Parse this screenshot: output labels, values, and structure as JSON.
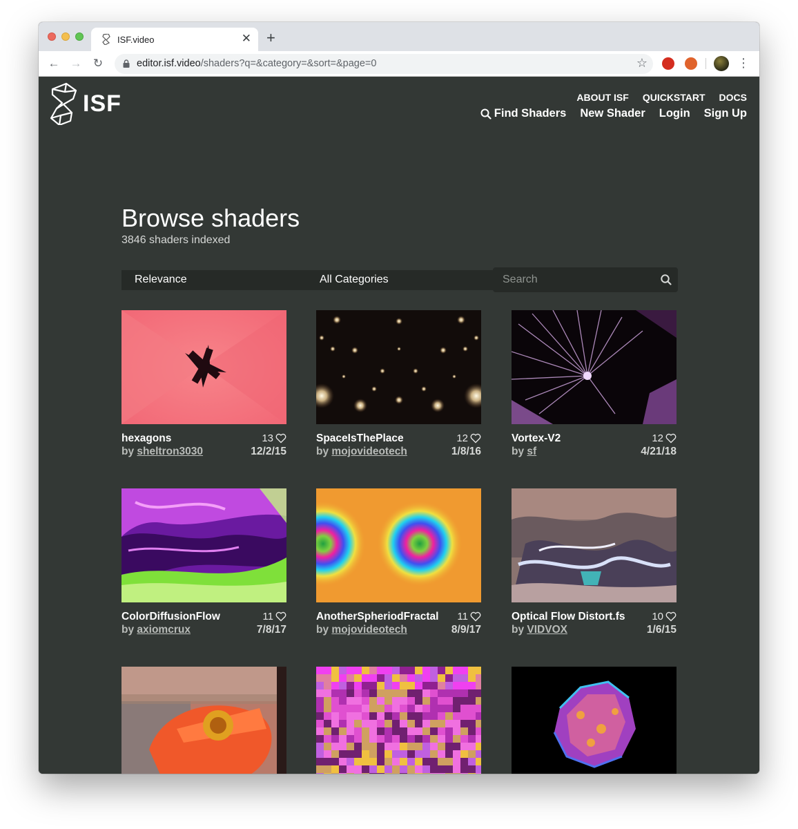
{
  "browser": {
    "tab_title": "ISF.video",
    "url_host": "editor.isf.video",
    "url_path": "/shaders?q=&category=&sort=&page=0"
  },
  "site": {
    "logo_text": "ISF",
    "nav_upper": [
      "ABOUT ISF",
      "QUICKSTART",
      "DOCS"
    ],
    "nav_lower": {
      "find": "Find Shaders",
      "new_shader": "New Shader",
      "login": "Login",
      "signup": "Sign Up"
    }
  },
  "main": {
    "title": "Browse shaders",
    "subtitle": "3846 shaders indexed",
    "filters": {
      "sort_selected": "Relevance",
      "category_selected": "All Categories",
      "search_placeholder": "Search"
    },
    "shaders": [
      {
        "name": "hexagons",
        "likes": "13",
        "by": "by",
        "author": "sheltron3030",
        "date": "12/2/15",
        "thumb": "pink-x"
      },
      {
        "name": "SpaceIsThePlace",
        "likes": "12",
        "by": "by",
        "author": "mojovideotech",
        "date": "1/8/16",
        "thumb": "stars"
      },
      {
        "name": "Vortex-V2",
        "likes": "12",
        "by": "by",
        "author": "sf",
        "date": "4/21/18",
        "thumb": "vortex"
      },
      {
        "name": "ColorDiffusionFlow",
        "likes": "11",
        "by": "by",
        "author": "axiomcrux",
        "date": "7/8/17",
        "thumb": "marble"
      },
      {
        "name": "AnotherSpheriodFractal",
        "likes": "11",
        "by": "by",
        "author": "mojovideotech",
        "date": "8/9/17",
        "thumb": "rainbow-rings"
      },
      {
        "name": "Optical Flow Distort.fs",
        "likes": "10",
        "by": "by",
        "author": "VIDVOX",
        "date": "1/6/15",
        "thumb": "distort"
      },
      {
        "name": "",
        "likes": "",
        "by": "",
        "author": "",
        "date": "",
        "thumb": "flower"
      },
      {
        "name": "",
        "likes": "",
        "by": "",
        "author": "",
        "date": "",
        "thumb": "pixels"
      },
      {
        "name": "",
        "likes": "",
        "by": "",
        "author": "",
        "date": "",
        "thumb": "blob"
      }
    ]
  },
  "colors": {
    "page_bg": "#333835",
    "control_bg": "#262a27",
    "text": "#ffffff"
  }
}
